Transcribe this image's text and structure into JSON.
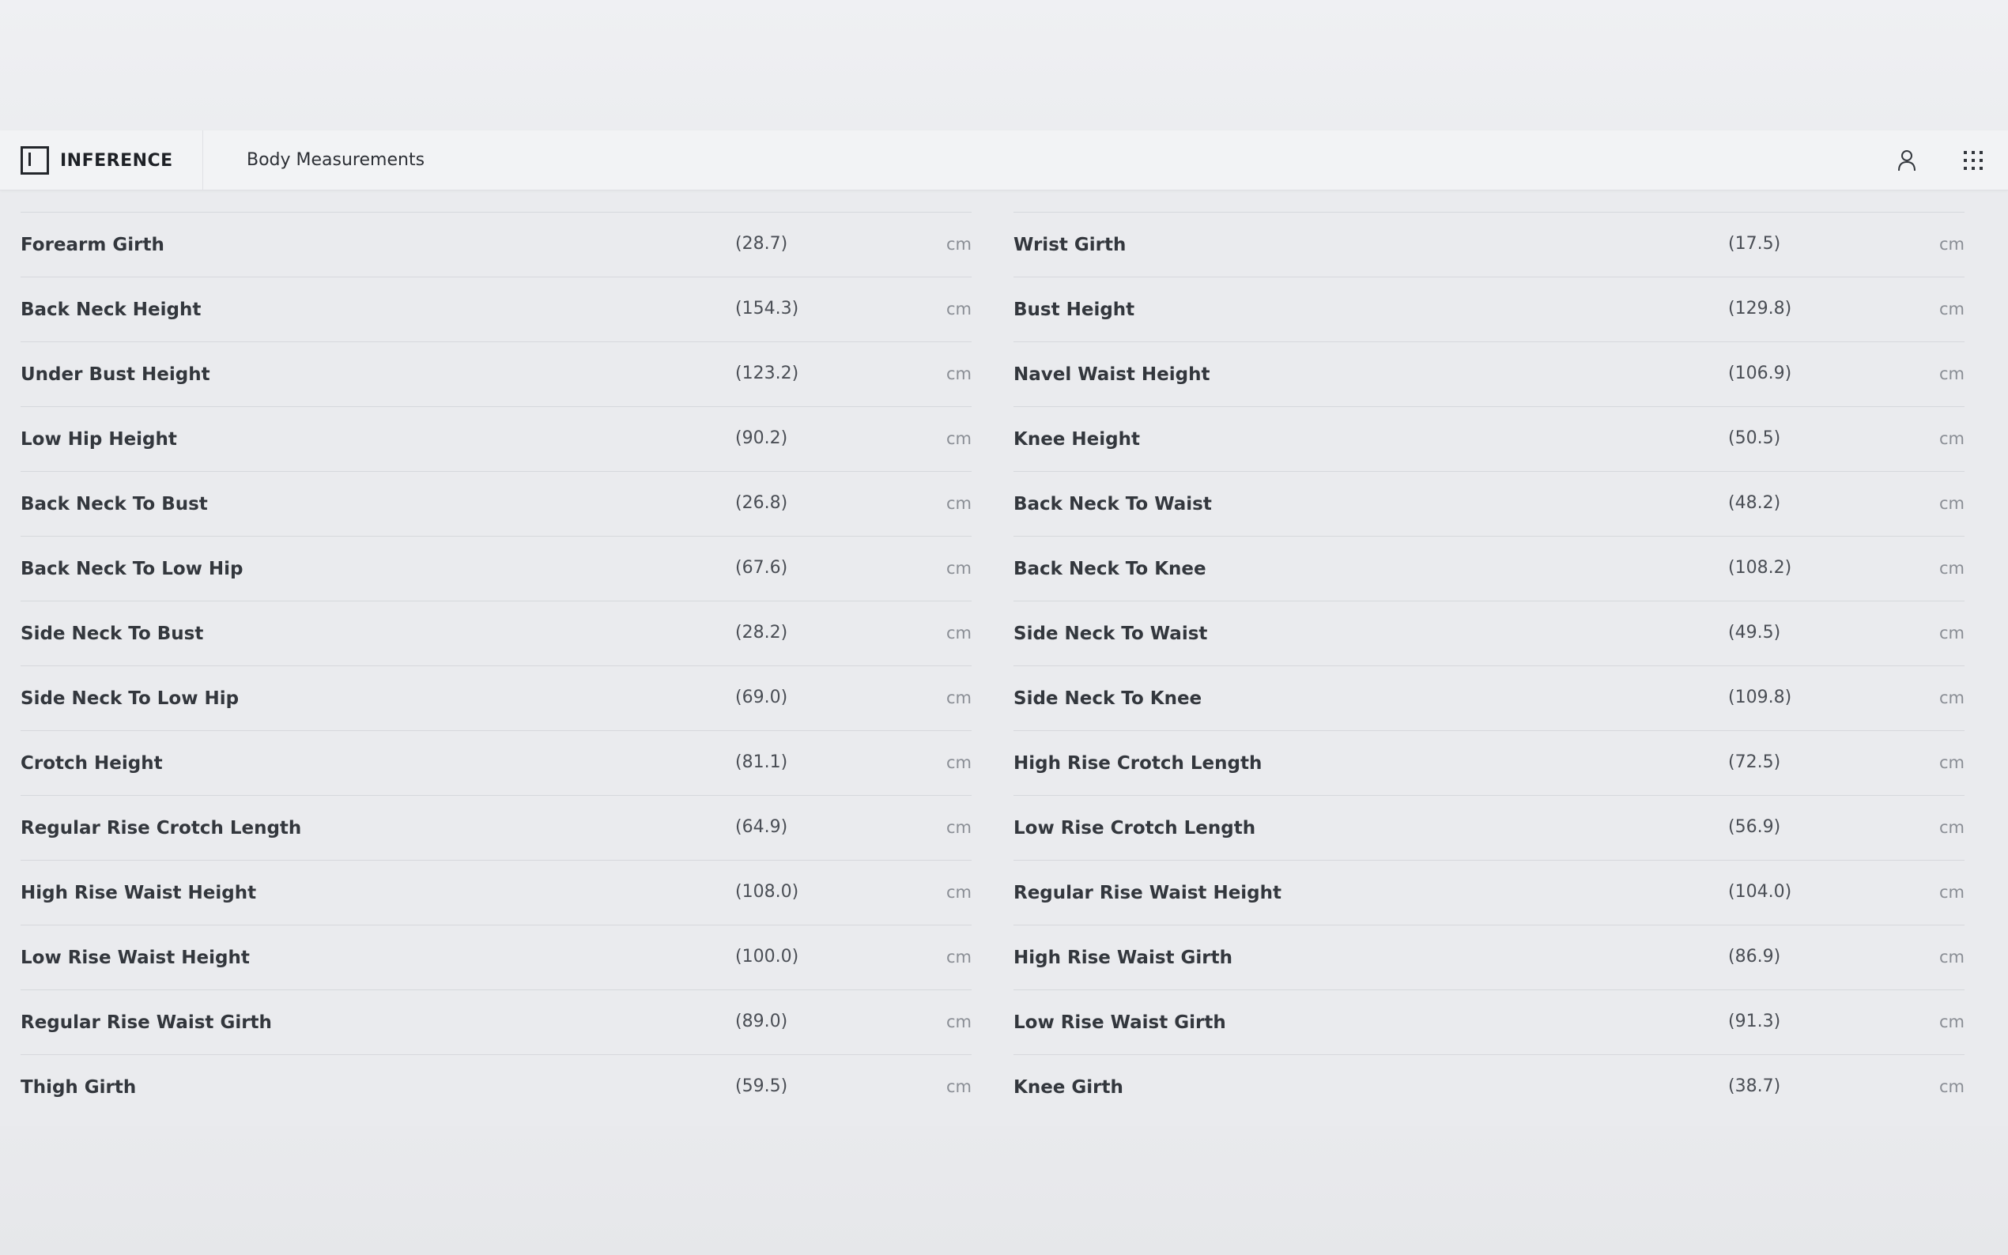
{
  "header": {
    "logo_text": "INFERENCE",
    "page_title": "Body Measurements"
  },
  "icons": {
    "user": "user-icon",
    "apps": "apps-grid-icon"
  },
  "measurements": {
    "left": [
      {
        "label": "Forearm Girth",
        "value": "(28.7)",
        "unit": "cm"
      },
      {
        "label": "Back Neck Height",
        "value": "(154.3)",
        "unit": "cm"
      },
      {
        "label": "Under Bust Height",
        "value": "(123.2)",
        "unit": "cm"
      },
      {
        "label": "Low Hip Height",
        "value": "(90.2)",
        "unit": "cm"
      },
      {
        "label": "Back Neck To Bust",
        "value": "(26.8)",
        "unit": "cm"
      },
      {
        "label": "Back Neck To Low Hip",
        "value": "(67.6)",
        "unit": "cm"
      },
      {
        "label": "Side Neck To Bust",
        "value": "(28.2)",
        "unit": "cm"
      },
      {
        "label": "Side Neck To Low Hip",
        "value": "(69.0)",
        "unit": "cm"
      },
      {
        "label": "Crotch Height",
        "value": "(81.1)",
        "unit": "cm"
      },
      {
        "label": "Regular Rise Crotch Length",
        "value": "(64.9)",
        "unit": "cm"
      },
      {
        "label": "High Rise Waist Height",
        "value": "(108.0)",
        "unit": "cm"
      },
      {
        "label": "Low Rise Waist Height",
        "value": "(100.0)",
        "unit": "cm"
      },
      {
        "label": "Regular Rise Waist Girth",
        "value": "(89.0)",
        "unit": "cm"
      },
      {
        "label": "Thigh Girth",
        "value": "(59.5)",
        "unit": "cm"
      }
    ],
    "right": [
      {
        "label": "Wrist Girth",
        "value": "(17.5)",
        "unit": "cm"
      },
      {
        "label": "Bust Height",
        "value": "(129.8)",
        "unit": "cm"
      },
      {
        "label": "Navel Waist Height",
        "value": "(106.9)",
        "unit": "cm"
      },
      {
        "label": "Knee Height",
        "value": "(50.5)",
        "unit": "cm"
      },
      {
        "label": "Back Neck To Waist",
        "value": "(48.2)",
        "unit": "cm"
      },
      {
        "label": "Back Neck To Knee",
        "value": "(108.2)",
        "unit": "cm"
      },
      {
        "label": "Side Neck To Waist",
        "value": "(49.5)",
        "unit": "cm"
      },
      {
        "label": "Side Neck To Knee",
        "value": "(109.8)",
        "unit": "cm"
      },
      {
        "label": "High Rise Crotch Length",
        "value": "(72.5)",
        "unit": "cm"
      },
      {
        "label": "Low Rise Crotch Length",
        "value": "(56.9)",
        "unit": "cm"
      },
      {
        "label": "Regular Rise Waist Height",
        "value": "(104.0)",
        "unit": "cm"
      },
      {
        "label": "High Rise Waist Girth",
        "value": "(86.9)",
        "unit": "cm"
      },
      {
        "label": "Low Rise Waist Girth",
        "value": "(91.3)",
        "unit": "cm"
      },
      {
        "label": "Knee Girth",
        "value": "(38.7)",
        "unit": "cm"
      }
    ]
  }
}
